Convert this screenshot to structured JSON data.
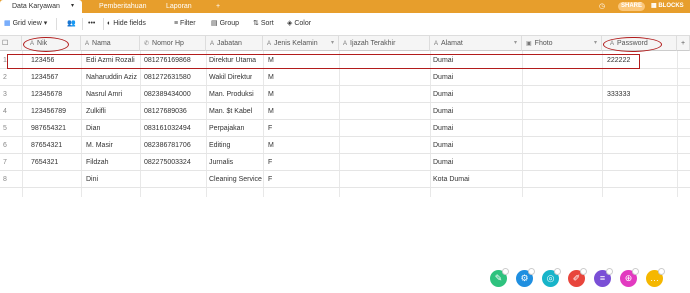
{
  "tabs": {
    "active": "Data Karyawan",
    "others": [
      "Pemberitahuan",
      "Laporan"
    ]
  },
  "topbar": {
    "share": "SHARE",
    "blocks": "BLOCKS",
    "bg_color": "#e79e2c"
  },
  "toolbar": {
    "grid_view": "Grid view",
    "hide_fields": "Hide fields",
    "filter": "Filter",
    "group": "Group",
    "sort": "Sort",
    "color": "Color"
  },
  "columns": [
    "Nik",
    "Nama",
    "Nomor Hp",
    "Jabatan",
    "Jenis Kelamin",
    "Ijazah Terakhir",
    "Alamat",
    "Fhoto",
    "Password"
  ],
  "rows": [
    {
      "n": "1",
      "nik": "123456",
      "nama": "Edi Azmi Rozali",
      "hp": "081276169868",
      "jabatan": "Direktur Utama",
      "jk": "M",
      "ijazah": "",
      "alamat": "Dumai",
      "foto": true,
      "password": "222222"
    },
    {
      "n": "2",
      "nik": "1234567",
      "nama": "Naharuddin Aziz",
      "hp": "081272631580",
      "jabatan": "Wakil Direktur",
      "jk": "M",
      "ijazah": "",
      "alamat": "Dumai",
      "foto": false,
      "password": ""
    },
    {
      "n": "3",
      "nik": "12345678",
      "nama": "Nasrul Amri",
      "hp": "082389434000",
      "jabatan": "Man. Produksi",
      "jk": "M",
      "ijazah": "",
      "alamat": "Dumai",
      "foto": false,
      "password": "333333"
    },
    {
      "n": "4",
      "nik": "123456789",
      "nama": "Zulkifli",
      "hp": "08127689036",
      "jabatan": "Man. $t Kabel",
      "jk": "M",
      "ijazah": "",
      "alamat": "Dumai",
      "foto": false,
      "password": ""
    },
    {
      "n": "5",
      "nik": "987654321",
      "nama": "Dian",
      "hp": "083161032494",
      "jabatan": "Perpajakan",
      "jk": "F",
      "ijazah": "",
      "alamat": "Dumai",
      "foto": false,
      "password": ""
    },
    {
      "n": "6",
      "nik": "87654321",
      "nama": "M. Masir",
      "hp": "082386781706",
      "jabatan": "Editing",
      "jk": "M",
      "ijazah": "",
      "alamat": "Dumai",
      "foto": false,
      "password": ""
    },
    {
      "n": "7",
      "nik": "7654321",
      "nama": "Fildzah",
      "hp": "082275003324",
      "jabatan": "Jurnalis",
      "jk": "F",
      "ijazah": "",
      "alamat": "Dumai",
      "foto": false,
      "password": ""
    },
    {
      "n": "8",
      "nik": "",
      "nama": "Dini",
      "hp": "",
      "jabatan": "Cleaning Service",
      "jk": "F",
      "ijazah": "",
      "alamat": "Kota Dumai",
      "foto": false,
      "password": ""
    }
  ],
  "fab_colors": [
    "#2ec27e",
    "#1f8fe0",
    "#17b4c9",
    "#e8453c",
    "#7a4fd6",
    "#e23ac0",
    "#f5b700"
  ]
}
